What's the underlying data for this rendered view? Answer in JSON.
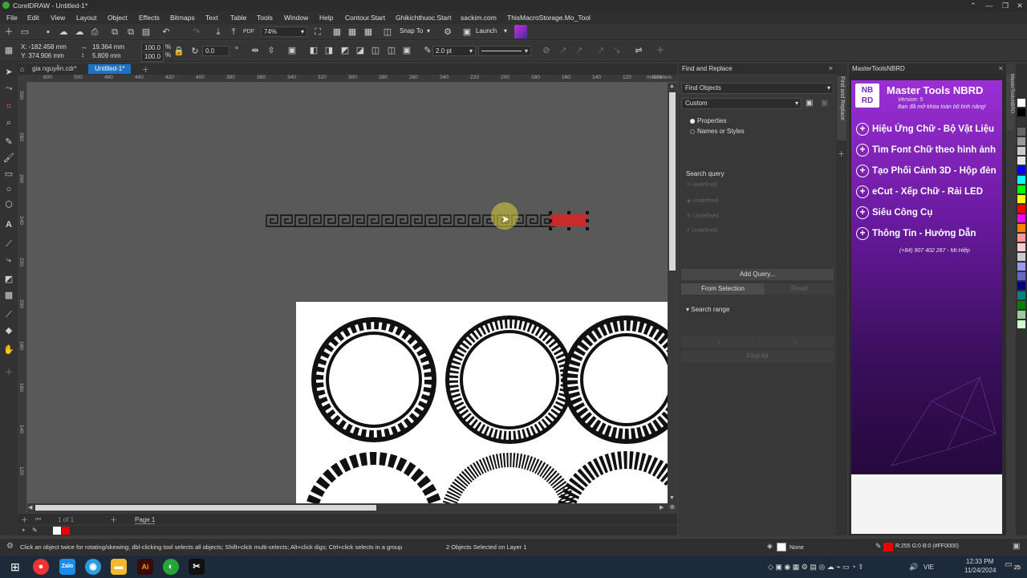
{
  "window": {
    "title": "CorelDRAW - Untitled-1*",
    "controls": [
      "⌃",
      "—",
      "❐",
      "✕"
    ]
  },
  "menu": [
    "File",
    "Edit",
    "View",
    "Layout",
    "Object",
    "Effects",
    "Bitmaps",
    "Text",
    "Table",
    "Tools",
    "Window",
    "Help",
    "Contour.Start",
    "Ghikichthuoc.Start",
    "sackim.com",
    "ThisMacroStorage.Mo_Tool"
  ],
  "toolbar": {
    "zoom": "74%",
    "snap_to": "Snap To",
    "launch": "Launch"
  },
  "propbar": {
    "x": "X: -182.458 mm",
    "y": "Y: 374.906 mm",
    "width": "19.364 mm",
    "height": "5.809 mm",
    "scale_w": "100.0",
    "scale_h": "100.0",
    "pct": "%",
    "angle": "0.0",
    "outline": "2.0 pt"
  },
  "tabs": [
    "gia nguyễn.cdr*",
    "Untitled-1*"
  ],
  "ruler_h": [
    "600",
    "500",
    "460",
    "440",
    "420",
    "400",
    "380",
    "360",
    "340",
    "320",
    "300",
    "280",
    "260",
    "240",
    "220",
    "200",
    "180",
    "160",
    "140",
    "120",
    "100",
    "millimeters"
  ],
  "ruler_v": [
    "300",
    "280",
    "260",
    "240",
    "220",
    "200",
    "180",
    "160",
    "140",
    "120"
  ],
  "pagenav": {
    "count": "1 of 1",
    "page": "Page 1"
  },
  "find": {
    "title": "Find and Replace",
    "mode": "Find Objects",
    "preset": "Custom",
    "opt1": "Properties",
    "opt2": "Names or Styles",
    "search_query": "Search query",
    "q_items": [
      "Undefined",
      "Undefined",
      "Undefined",
      "Undefined"
    ],
    "add_query": "Add Query...",
    "from_selection": "From Selection",
    "reset": "Reset",
    "search_range": "Search range",
    "find_all": "Find All",
    "side_tab": "Find and Replace"
  },
  "mastertools": {
    "header": "MasterToolsNBRD",
    "logo": "NB RD",
    "title": "Master Tools NBRD",
    "version": "Version: 5",
    "tagline": "Bạn đã mở khóa toàn bộ tính năng!",
    "items": [
      "Hiệu Ứng Chữ - Bộ Vật Liệu",
      "Tìm Font Chữ theo hình ảnh",
      "Tạo Phối Cảnh 3D - Hộp đèn",
      "eCut - Xếp Chữ - Rải LED",
      "Siêu Công Cụ",
      "Thông Tin  - Hướng Dẫn"
    ],
    "contact": "(+84) 907 402 267 - Mr.Hiệp",
    "side_tab": "MasterToolsNBRD"
  },
  "status": {
    "hint": "Click an object twice for rotating/skewing; dbl-clicking tool selects all objects; Shift+click multi-selects; Alt+click digs; Ctrl+click selects in a group",
    "selection": "2 Objects Selected on Layer 1",
    "fill": "None",
    "color": "R:255 G:0 B:0 (#FF0000)"
  },
  "taskbar": {
    "lang": "VIE",
    "time": "12:33 PM",
    "date": "11/24/2024",
    "badge": "25"
  },
  "palette": [
    "#ffffff",
    "#000000",
    "#333333",
    "#666666",
    "#999999",
    "#cccccc",
    "#e6e6e6",
    "#0000ff",
    "#00ffff",
    "#00ff00",
    "#ffff00",
    "#ff0000",
    "#ff00ff",
    "#ff8000",
    "#ff9999",
    "#ffcccc",
    "#cccccc",
    "#9999ff",
    "#6666cc",
    "#000080",
    "#008080",
    "#008000",
    "#99cc99",
    "#ccffcc"
  ]
}
